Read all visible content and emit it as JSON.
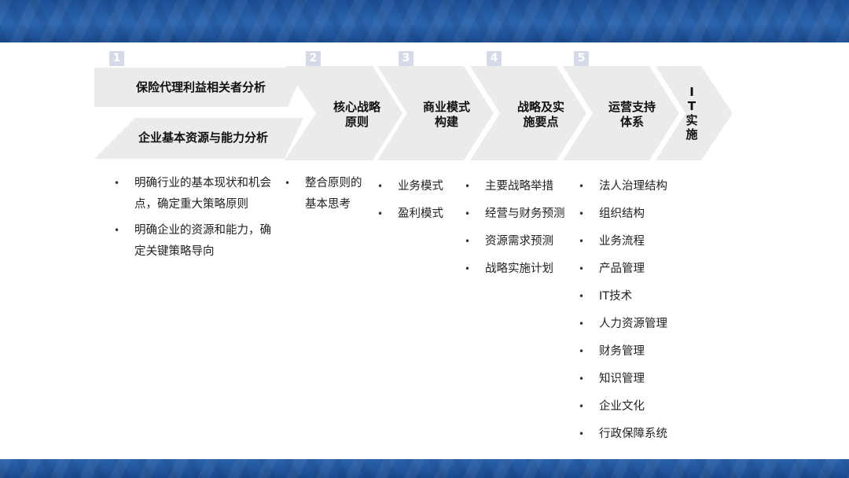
{
  "steps": [
    {
      "num": "1",
      "label_a": "保险代理利益相关者分析",
      "label_b": "企业基本资源与能力分析"
    },
    {
      "num": "2",
      "label_a": "核心战略",
      "label_b": "原则"
    },
    {
      "num": "3",
      "label_a": "商业模式",
      "label_b": "构建"
    },
    {
      "num": "4",
      "label_a": "战略及实",
      "label_b": "施要点"
    },
    {
      "num": "5",
      "label_a": "运营支持",
      "label_b": "体系"
    },
    {
      "label_chars": [
        "I",
        "T",
        "实",
        "施"
      ]
    }
  ],
  "columns": {
    "col1": [
      "明确行业的基本现状和机会点，确定重大策略原则",
      "明确企业的资源和能力，确定关键策略导向"
    ],
    "col2": [
      "整合原则的基本思考"
    ],
    "col3": [
      "业务模式",
      "盈利模式"
    ],
    "col4": [
      "主要战略举措",
      "经营与财务预测",
      "资源需求预测",
      "战略实施计划"
    ],
    "col5": [
      "法人治理结构",
      "组织结构",
      "业务流程",
      "产品管理",
      "IT技术",
      "人力资源管理",
      "财务管理",
      "知识管理",
      "企业文化",
      "行政保障系统"
    ]
  },
  "colors": {
    "band": "#2a63ad",
    "chevron": "#ebebeb",
    "number_box": "#d6d9e8"
  }
}
